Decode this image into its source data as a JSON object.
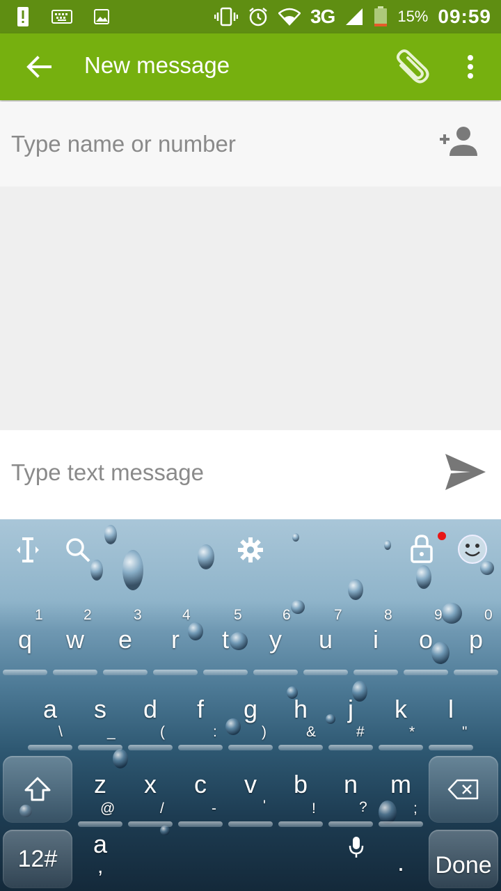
{
  "status_bar": {
    "network": "3G",
    "battery_percent": "15%",
    "time": "09:59",
    "icons": [
      "notification-alert-icon",
      "keyboard-icon",
      "image-icon",
      "vibrate-icon",
      "alarm-icon",
      "wifi-icon",
      "signal-icon",
      "battery-icon"
    ]
  },
  "app_bar": {
    "title": "New message",
    "icons": [
      "back-arrow-icon",
      "attachment-icon",
      "overflow-menu-icon"
    ],
    "color": "#76b00f"
  },
  "recipient": {
    "placeholder": "Type name or number"
  },
  "composer": {
    "placeholder": "Type text message"
  },
  "keyboard": {
    "toolbar_icons": [
      "text-cursor-icon",
      "search-icon",
      "settings-icon",
      "lock-icon",
      "emoji-icon"
    ],
    "row1": [
      {
        "key": "q",
        "hint": "1"
      },
      {
        "key": "w",
        "hint": "2"
      },
      {
        "key": "e",
        "hint": "3"
      },
      {
        "key": "r",
        "hint": "4"
      },
      {
        "key": "t",
        "hint": "5"
      },
      {
        "key": "y",
        "hint": "6"
      },
      {
        "key": "u",
        "hint": "7"
      },
      {
        "key": "i",
        "hint": "8"
      },
      {
        "key": "o",
        "hint": "9"
      },
      {
        "key": "p",
        "hint": "0"
      }
    ],
    "row2": [
      {
        "key": "a",
        "hint": "\\"
      },
      {
        "key": "s",
        "hint": "_"
      },
      {
        "key": "d",
        "hint": "("
      },
      {
        "key": "f",
        "hint": ":"
      },
      {
        "key": "g",
        "hint": ")"
      },
      {
        "key": "h",
        "hint": "&"
      },
      {
        "key": "j",
        "hint": "#"
      },
      {
        "key": "k",
        "hint": "*"
      },
      {
        "key": "l",
        "hint": "\""
      }
    ],
    "row3": [
      {
        "key": "z",
        "hint": "@"
      },
      {
        "key": "x",
        "hint": "/"
      },
      {
        "key": "c",
        "hint": "-"
      },
      {
        "key": "v",
        "hint": "'"
      },
      {
        "key": "b",
        "hint": "!"
      },
      {
        "key": "n",
        "hint": "?"
      },
      {
        "key": "m",
        "hint": ";"
      }
    ],
    "row4": {
      "symbols_label": "12#",
      "comma_main": "a",
      "comma_hint": ",",
      "period_label": ".",
      "done_label": "Done"
    }
  }
}
